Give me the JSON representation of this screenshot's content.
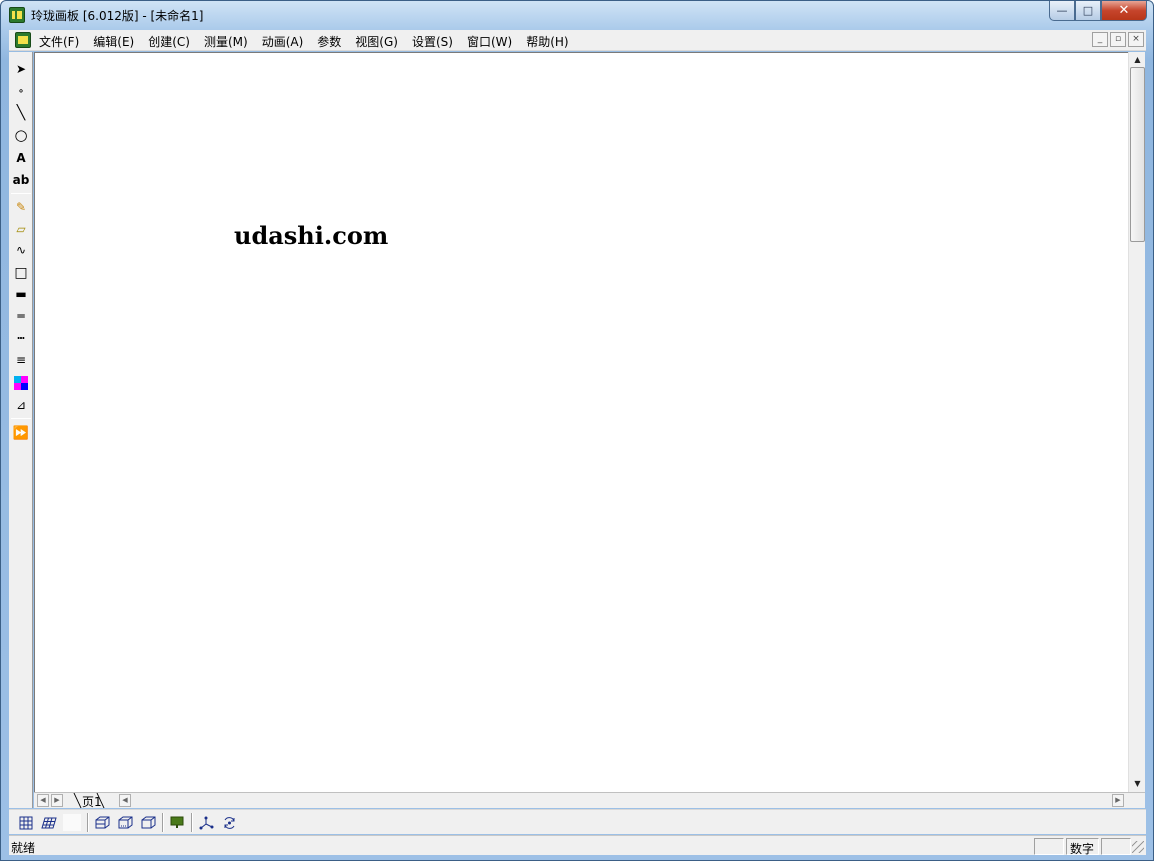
{
  "window": {
    "title": "玲珑画板 [6.012版] - [未命名1]",
    "caption_buttons": {
      "minimize": "—",
      "maximize": "□",
      "close": "✕"
    }
  },
  "menubar": {
    "items": [
      "文件(F)",
      "编辑(E)",
      "创建(C)",
      "测量(M)",
      "动画(A)",
      "参数",
      "视图(G)",
      "设置(S)",
      "窗口(W)",
      "帮助(H)"
    ],
    "mdi_buttons": [
      "_",
      "▫",
      "×"
    ]
  },
  "toolbox": {
    "tools": [
      {
        "name": "select-arrow-icon",
        "glyph": "➤"
      },
      {
        "name": "point-tool-icon",
        "glyph": "∘"
      },
      {
        "name": "line-tool-icon",
        "glyph": "╲"
      },
      {
        "name": "circle-tool-icon",
        "glyph": "○"
      },
      {
        "name": "text-label-tool-icon",
        "glyph": "A"
      },
      {
        "name": "text-box-tool-icon",
        "glyph": "ab"
      },
      {
        "name": "pencil-tool-icon",
        "glyph": "✎"
      },
      {
        "name": "eraser-tool-icon",
        "glyph": "▱"
      },
      {
        "name": "freehand-tool-icon",
        "glyph": "∿"
      },
      {
        "name": "rectangle-tool-icon",
        "glyph": "□"
      },
      {
        "name": "thick-line-style-icon",
        "glyph": "▬"
      },
      {
        "name": "thin-line-style-icon",
        "glyph": "═"
      },
      {
        "name": "dotted-line-style-icon",
        "glyph": "┅"
      },
      {
        "name": "line-weight-icon",
        "glyph": "≡"
      },
      {
        "name": "color-palette-icon",
        "glyph": ""
      },
      {
        "name": "function-graph-icon",
        "glyph": "⊿"
      },
      {
        "name": "play-animation-icon",
        "glyph": "⏩"
      }
    ]
  },
  "canvas": {
    "watermark_text": "udashi.com"
  },
  "pagebar": {
    "tab_label": "页1"
  },
  "bottombar": {
    "tools": [
      "grid-icon",
      "skew-grid-icon",
      "blank-tool-icon",
      "cube-front-icon",
      "cube-side-icon",
      "cube-iso-icon",
      "display-screen-icon",
      "coordinate-axes-icon",
      "rotate-3d-icon"
    ]
  },
  "statusbar": {
    "status": "就绪",
    "num_indicator": "数字"
  },
  "colors": {
    "title_gradient_top": "#cfe3f5",
    "close_button": "#c6452c",
    "chrome_gray": "#f0f0f0",
    "icon_green": "#2d7a2d"
  }
}
